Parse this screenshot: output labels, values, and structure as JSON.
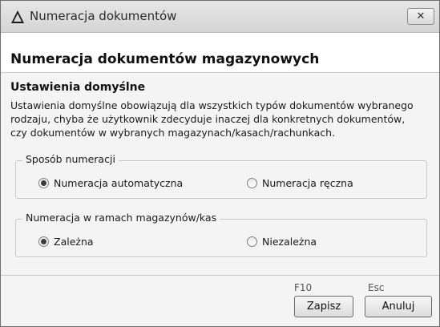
{
  "window": {
    "title": "Numeracja dokumentów",
    "close_glyph": "✕",
    "app_icon": "warning-triangle-icon"
  },
  "header": {
    "title": "Numeracja dokumentów magazynowych"
  },
  "defaults": {
    "title": "Ustawienia domyślne",
    "description_lines": [
      "Ustawienia domyślne obowiązują dla wszystkich typów dokumentów wybranego",
      "rodzaju, chyba że użytkownik zdecyduje inaczej dla konkretnych dokumentów,",
      "czy dokumentów w wybranych magazynach/kasach/rachunkach."
    ]
  },
  "numbering_method": {
    "legend": "Sposób numeracji",
    "options": [
      {
        "label": "Numeracja automatyczna",
        "checked": true
      },
      {
        "label": "Numeracja ręczna",
        "checked": false
      }
    ]
  },
  "warehouse_numbering": {
    "legend": "Numeracja w ramach magazynów/kas",
    "options": [
      {
        "label": "Zależna",
        "checked": true
      },
      {
        "label": "Niezależna",
        "checked": false
      }
    ]
  },
  "footer": {
    "save_hotkey": "F10",
    "cancel_hotkey": "Esc",
    "save_label": "Zapisz",
    "cancel_label": "Anuluj"
  }
}
